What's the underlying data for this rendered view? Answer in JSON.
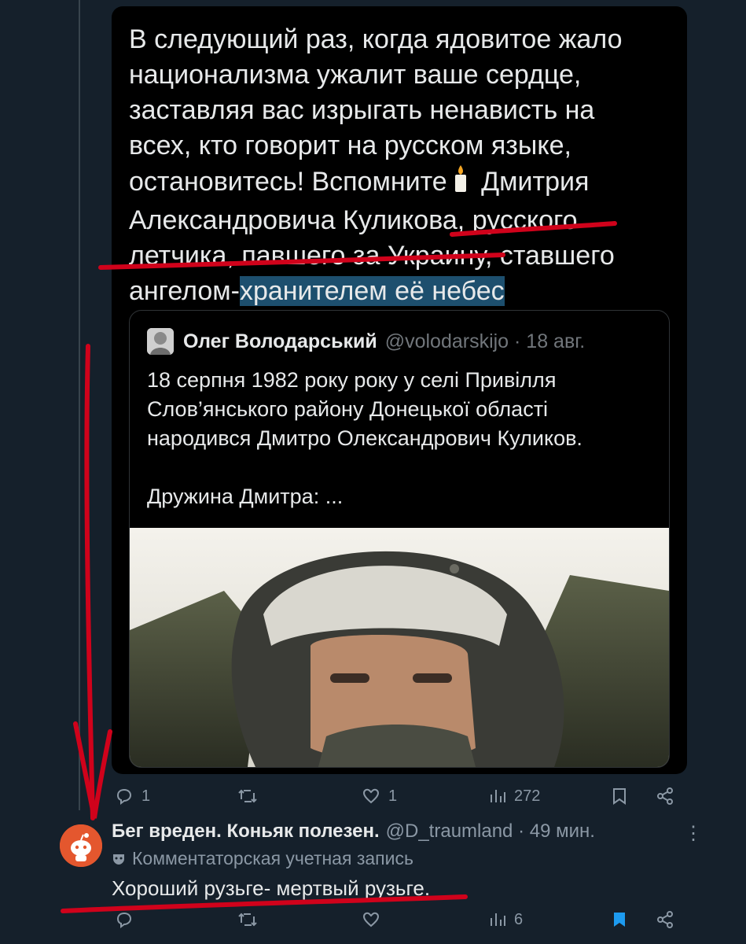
{
  "tweet": {
    "text_before": "В следующий раз, когда ядовитое жало\nнационализма ужалит ваше сердце,\nзаставляя вас изрыгать ненависть на\nвсех, кто говорит на русском языке,\nостановитесь! Вспомните",
    "text_middle": " Дмитрия\nАлександровича Куликова, русского\nлетчика, павшего за Украину, ставшего\nангелом-",
    "text_highlight": "хранителем её небес",
    "quote": {
      "name": "Олег Володарський",
      "handle": "@volodarskijo · 18 авг.",
      "body": "18 серпня 1982 року року у селі Привілля\nСлов’янського району Донецької області\nнародився Дмитро Олександрович Куликов.\n\nДружина Дмитра: ..."
    },
    "stats": {
      "replies": "1",
      "reposts": "",
      "likes": "1",
      "views": "272"
    }
  },
  "reply": {
    "name": "Бег вреден. Коньяк полезен.",
    "handle": "@D_traumland · 49 мин.",
    "subtitle": "Комментаторская учетная запись",
    "text": "Хороший рузьге- мертвый рузьге.",
    "stats": {
      "views": "6"
    }
  },
  "colors": {
    "background": "#15202b",
    "card": "#000000",
    "highlight": "#1d4f6e",
    "marker": "#d0021b",
    "bookmark_active": "#1d9bf0"
  },
  "icons": [
    "candle-emoji",
    "reply-icon",
    "repost-icon",
    "like-icon",
    "views-icon",
    "bookmark-icon",
    "share-icon",
    "more-icon",
    "mask-icon"
  ]
}
